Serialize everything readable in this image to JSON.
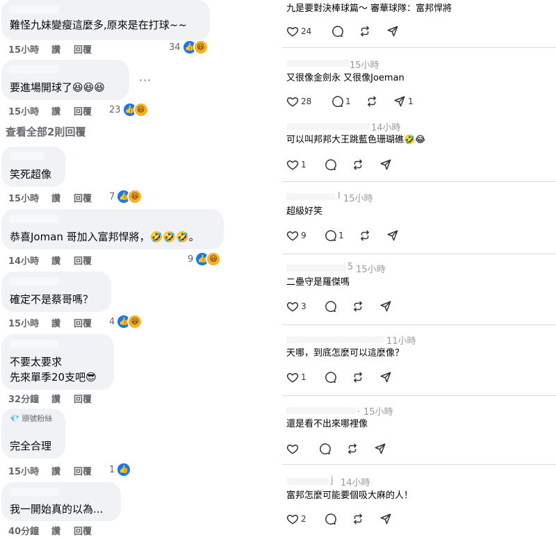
{
  "facebook": {
    "comments": [
      {
        "text": "難怪九妹變瘦這麼多,原來是在打球~~",
        "time": "15小時",
        "like": "讚",
        "reply": "回覆",
        "count": "34"
      },
      {
        "text": "要進場開球了😆😆😆",
        "time": "15小時",
        "like": "讚",
        "reply": "回覆",
        "count": "23"
      },
      {
        "text": "笑死超像",
        "time": "15小時",
        "like": "讚",
        "reply": "回覆",
        "count": "7"
      },
      {
        "text": "恭喜Joman 哥加入富邦悍將，🤣🤣🤣。",
        "time": "14小時",
        "like": "讚",
        "reply": "回覆",
        "count": "9"
      },
      {
        "text": "確定不是蔡哥嗎？",
        "time": "15小時",
        "like": "讚",
        "reply": "回覆",
        "count": "4"
      },
      {
        "text_line1": "不要太要求",
        "text_line2": "先來單季20支吧😎",
        "time": "32分鐘",
        "like": "讚",
        "reply": "回覆"
      },
      {
        "badge": "💎 頭號粉絲",
        "text": "完全合理",
        "time": "15小時",
        "like": "讚",
        "reply": "回覆",
        "count": "1"
      },
      {
        "text": "我一開始真的以為...",
        "time": "40分鐘",
        "like": "讚",
        "reply": "回覆"
      }
    ],
    "see_all_replies": "查看全部2則回覆",
    "more_menu": "···"
  },
  "threads": {
    "posts": [
      {
        "text": "九是要對決棒球篇～ 審華球隊：富邦悍將",
        "likes": "24",
        "comments": "",
        "reposts": "",
        "shares": ""
      },
      {
        "time": "15小時",
        "text": "又很像金劍永 又很像Joeman",
        "likes": "28",
        "comments": "1",
        "reposts": "",
        "shares": "1"
      },
      {
        "time": "14小時",
        "text": "可以叫邦邦大王跳藍色珊瑚礁🤣😂",
        "likes": "1",
        "comments": "",
        "reposts": "",
        "shares": ""
      },
      {
        "time_prefix": "l",
        "time": "15小時",
        "text": "超級好笑",
        "likes": "9",
        "comments": "1",
        "reposts": "",
        "shares": ""
      },
      {
        "time_prefix": "5",
        "time": "15小時",
        "text": "二壘守是羅傑嗎",
        "likes": "3",
        "comments": "",
        "reposts": "",
        "shares": ""
      },
      {
        "time": "11小時",
        "text": "天哪，到底怎麼可以這麼像？",
        "likes": "1",
        "comments": "",
        "reposts": "",
        "shares": ""
      },
      {
        "time_prefix": ".",
        "time": "15小時",
        "text": "還是看不出來哪裡像",
        "likes": "",
        "comments": "",
        "reposts": "",
        "shares": ""
      },
      {
        "time_prefix": "j",
        "time": "14小時",
        "text": "富邦怎麼可能要個吸大麻的人！",
        "likes": "2",
        "comments": "",
        "reposts": "",
        "shares": ""
      }
    ]
  },
  "icons": {
    "like_reaction": "thumbs-up-icon",
    "haha_reaction": "haha-emoji-icon",
    "heart": "heart-icon",
    "comment": "comment-bubble-icon",
    "repost": "repost-icon",
    "share": "send-icon",
    "diamond": "diamond-icon"
  },
  "colors": {
    "fb_bubble": "#f0f2f5",
    "fb_meta": "#65676b",
    "fb_like_blue": "#1877f2",
    "haha_yellow": "#f7b125",
    "threads_time": "#999999",
    "separator": "#d9d9d9"
  }
}
